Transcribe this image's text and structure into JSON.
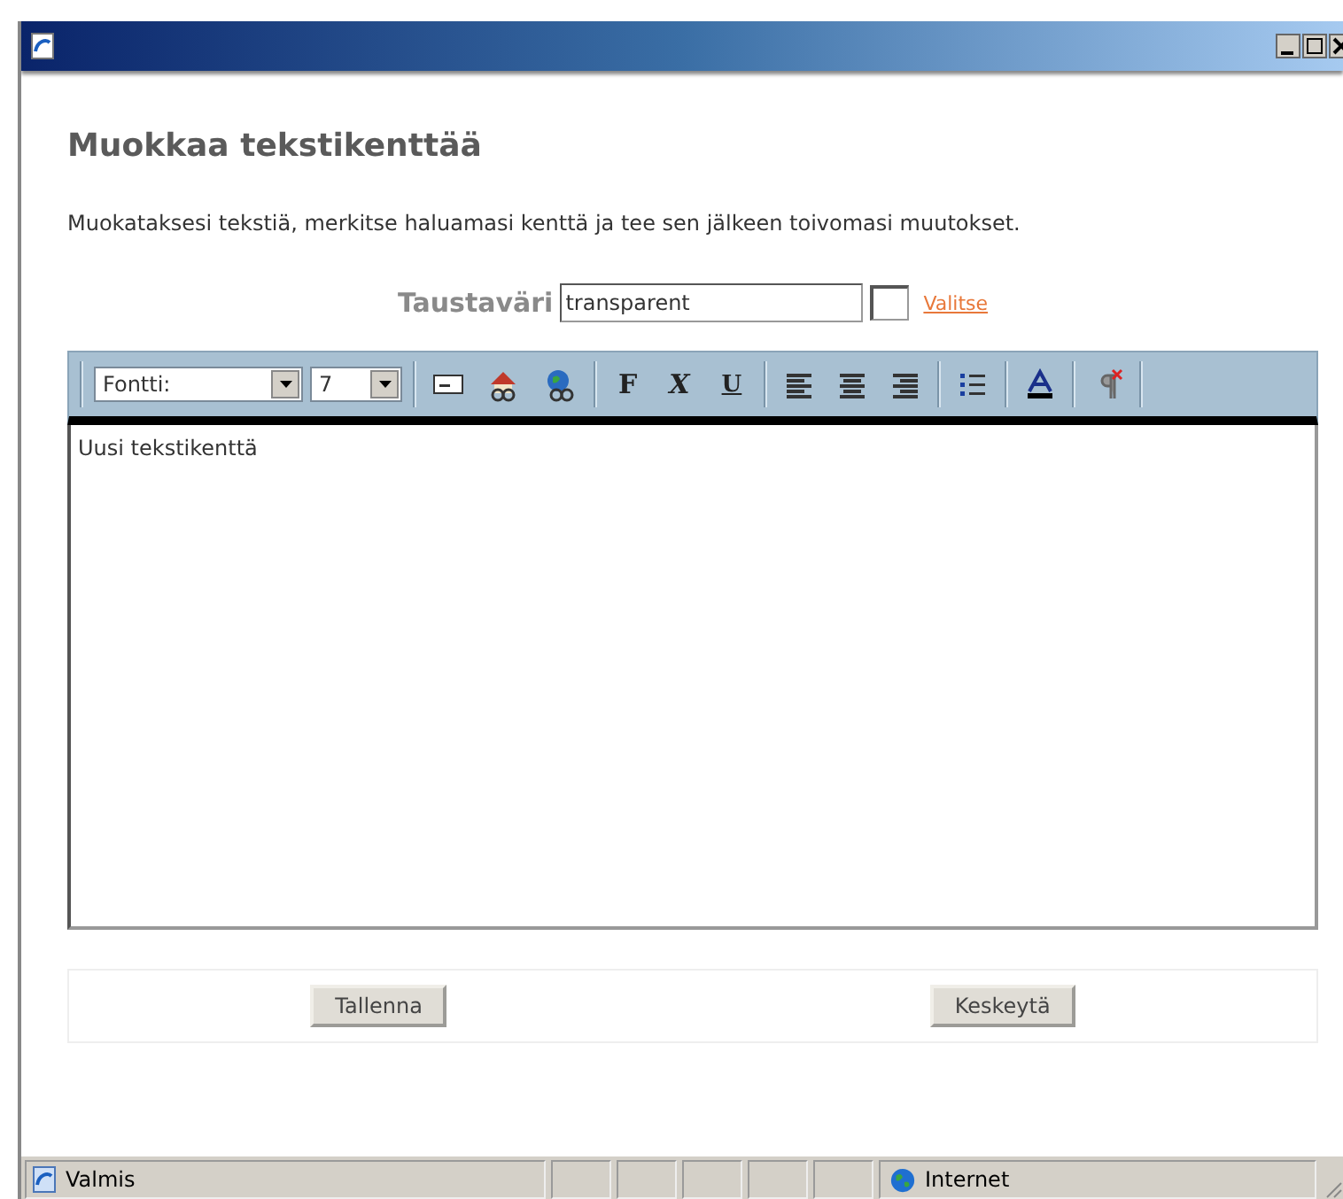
{
  "heading": "Muokkaa tekstikenttää",
  "instructions": "Muokataksesi tekstiä, merkitse haluamasi kenttä ja tee sen jälkeen toivomasi muutokset.",
  "background_color": {
    "label": "Taustaväri",
    "value": "transparent",
    "link": "Valitse"
  },
  "toolbar": {
    "font": "Fontti:",
    "size": "7",
    "format_buttons": [
      "F",
      "X",
      "U"
    ]
  },
  "editor": {
    "content": "Uusi tekstikenttä"
  },
  "buttons": [
    "Tallenna",
    "Keskeytä"
  ],
  "status_bar": {
    "text": "Valmis",
    "zone": "Internet"
  }
}
